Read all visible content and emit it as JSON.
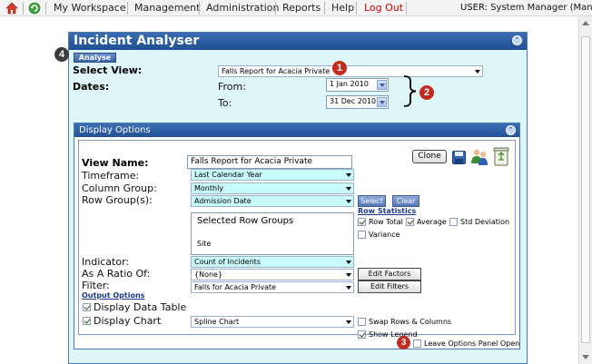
{
  "nav": {
    "items": [
      "My Workspace",
      "Management",
      "Administration",
      "Reports",
      "Help",
      "Log Out"
    ],
    "user": "USER: System Manager (Manager)"
  },
  "analyser": {
    "title": "Incident Analyser",
    "analyse_button": "Analyse",
    "select_view_label": "Select View:",
    "select_view_value": "Falls Report for Acacia Private",
    "dates_label": "Dates:",
    "from_label": "From:",
    "from_value": "1 Jan 2010",
    "to_label": "To:",
    "to_value": "31 Dec 2010"
  },
  "callouts": [
    "1",
    "2",
    "3",
    "4"
  ],
  "display": {
    "title": "Display Options",
    "view_name_label": "View Name:",
    "view_name_value": "Falls Report for Acacia Private",
    "clone_button": "Clone",
    "timeframe_label": "Timeframe:",
    "timeframe_value": "Last Calendar Year",
    "column_group_label": "Column Group:",
    "column_group_value": "Monthly",
    "row_groups_label": "Row Group(s):",
    "row_group_value": "Admission Date",
    "select_button": "Select",
    "clear_button": "Clear",
    "selected_row_groups_heading": "Selected Row Groups",
    "selected_row_groups_item": "Site",
    "row_statistics_heading": "Row Statistics",
    "row_stats": [
      {
        "label": "Row Total",
        "checked": true
      },
      {
        "label": "Average",
        "checked": true
      },
      {
        "label": "Std Deviation",
        "checked": false
      },
      {
        "label": "Variance",
        "checked": false
      }
    ],
    "indicator_label": "Indicator:",
    "indicator_value": "Count of Incidents",
    "ratio_label": "As A Ratio Of:",
    "ratio_value": "{None}",
    "edit_factors_button": "Edit Factors",
    "filter_label": "Filter:",
    "filter_value": "Falls for Acacia Private",
    "edit_filters_button": "Edit Filters",
    "output_options_heading": "Output Options",
    "display_data_table_label": "Display Data Table",
    "display_data_table_checked": true,
    "display_chart_label": "Display Chart",
    "display_chart_checked": true,
    "chart_type_value": "Spline Chart",
    "swap_rows_label": "Swap Rows & Columns",
    "swap_rows_checked": false,
    "show_legend_label": "Show Legend",
    "show_legend_checked": true,
    "leave_open_label": "Leave Options Panel Open",
    "leave_open_checked": false
  },
  "colors": {
    "title_bar": "#2a5aa0",
    "panel_bg": "#dff6f8",
    "highlight_field": "#c9fbfd",
    "callout_red": "#c42a1e",
    "logout_red": "#cc0000"
  }
}
